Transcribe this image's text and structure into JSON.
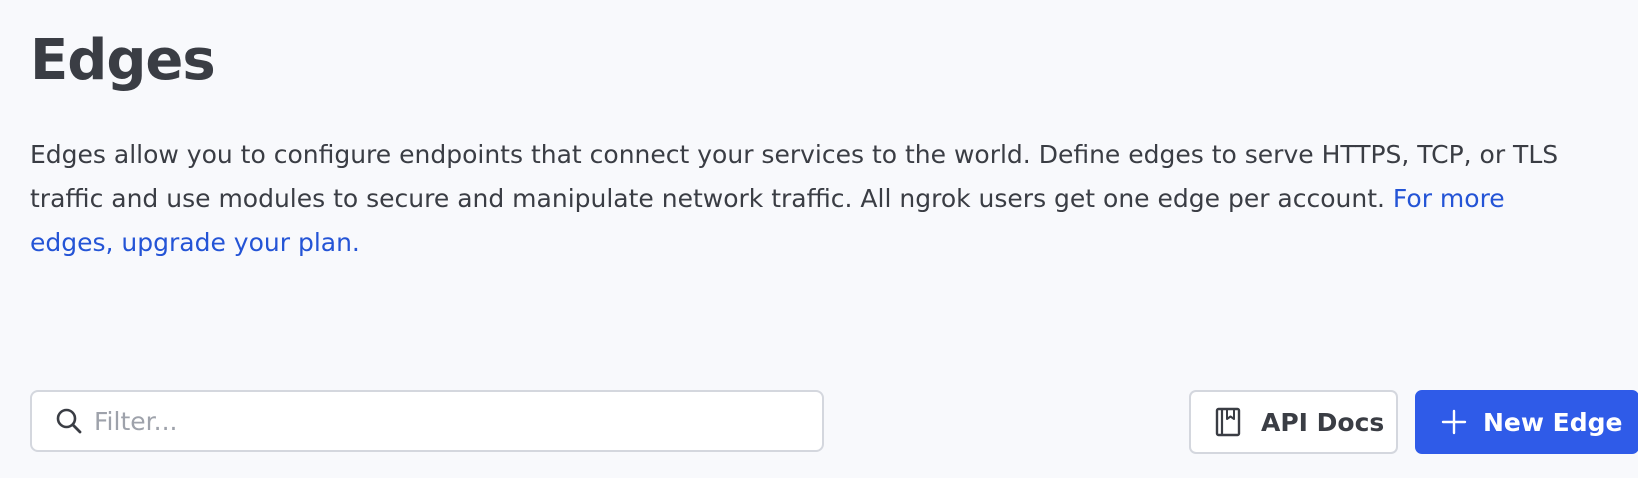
{
  "page": {
    "title": "Edges",
    "description": "Edges allow you to configure endpoints that connect your services to the world. Define edges to serve HTTPS, TCP, or TLS traffic and use modules to secure and manipulate network traffic. All ngrok users get one edge per account. ",
    "upgrade_link": "For more edges, upgrade your plan."
  },
  "toolbar": {
    "filter_placeholder": "Filter...",
    "filter_value": "",
    "api_docs_label": "API Docs",
    "new_edge_label": "New Edge",
    "search_icon": "search-icon",
    "api_docs_icon": "book-icon",
    "new_edge_icon": "plus-icon"
  },
  "colors": {
    "background": "#f8f9fc",
    "text": "#3a3d44",
    "link": "#2454d6",
    "primary_button": "#2f5be8",
    "border": "#d4d7de",
    "placeholder": "#9ea2ab"
  }
}
